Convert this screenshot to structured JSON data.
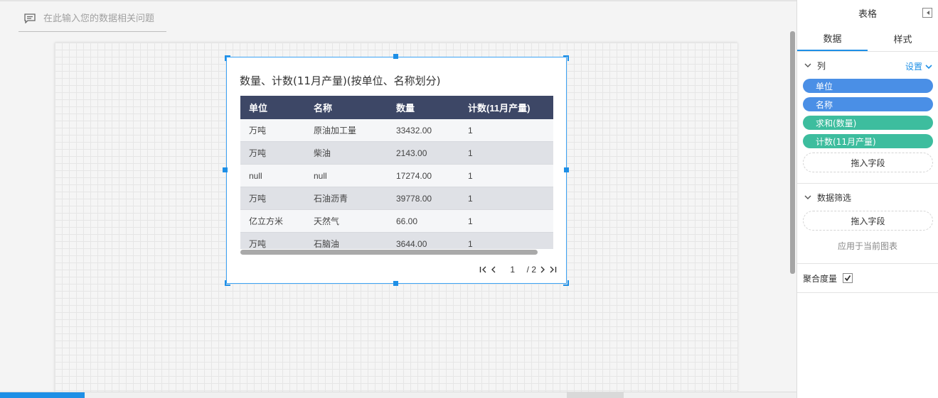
{
  "question": {
    "placeholder": "在此输入您的数据相关问题"
  },
  "widget": {
    "title": "数量、计数(11月产量)(按单位、名称划分)",
    "columns": [
      "单位",
      "名称",
      "数量",
      "计数(11月产量)"
    ],
    "rows": [
      [
        "万吨",
        "原油加工量",
        "33432.00",
        "1"
      ],
      [
        "万吨",
        "柴油",
        "2143.00",
        "1"
      ],
      [
        "null",
        "null",
        "17274.00",
        "1"
      ],
      [
        "万吨",
        "石油沥青",
        "39778.00",
        "1"
      ],
      [
        "亿立方米",
        "天然气",
        "66.00",
        "1"
      ],
      [
        "万吨",
        "石脑油",
        "3644.00",
        "1"
      ]
    ],
    "pager": {
      "current": "1",
      "total": "/ 2"
    }
  },
  "panel": {
    "title": "表格",
    "tabs": [
      "数据",
      "样式"
    ],
    "columns_section": {
      "label": "列",
      "settings": "设置",
      "fields": [
        {
          "label": "单位",
          "color": "#4a8fe6"
        },
        {
          "label": "名称",
          "color": "#4a8fe6"
        },
        {
          "label": "求和(数量)",
          "color": "#3dbd9e"
        },
        {
          "label": "计数(11月产量)",
          "color": "#3dbd9e"
        }
      ],
      "drop_label": "拖入字段"
    },
    "filter_section": {
      "label": "数据筛选",
      "drop_label": "拖入字段",
      "apply_text": "应用于当前图表"
    },
    "aggregate": {
      "label": "聚合度量",
      "checked": true
    }
  }
}
